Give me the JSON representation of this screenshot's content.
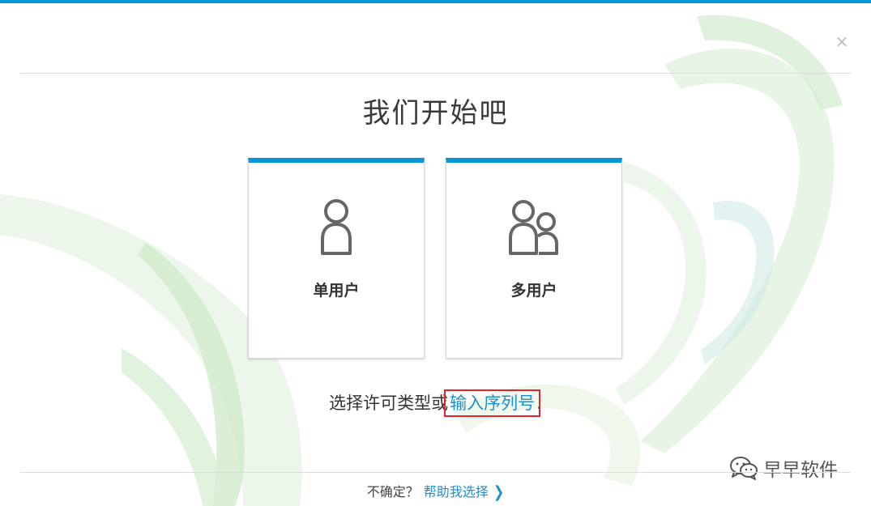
{
  "window": {
    "close_symbol": "×",
    "accent": "#0696d7"
  },
  "header": {
    "title": "我们开始吧"
  },
  "cards": [
    {
      "label": "单用户",
      "icon": "single-user-icon"
    },
    {
      "label": "多用户",
      "icon": "multi-user-icon"
    }
  ],
  "choose": {
    "prefix": "选择许可类型或",
    "serial_link": "输入序列号",
    "suffix": "."
  },
  "help": {
    "question": "不确定？",
    "link": "帮助我选择",
    "chevron": "❯"
  },
  "watermark": {
    "text": "早早软件",
    "icon": "wechat-icon"
  },
  "colors": {
    "link": "#1f8fcb",
    "highlight_box": "#e0262b"
  }
}
